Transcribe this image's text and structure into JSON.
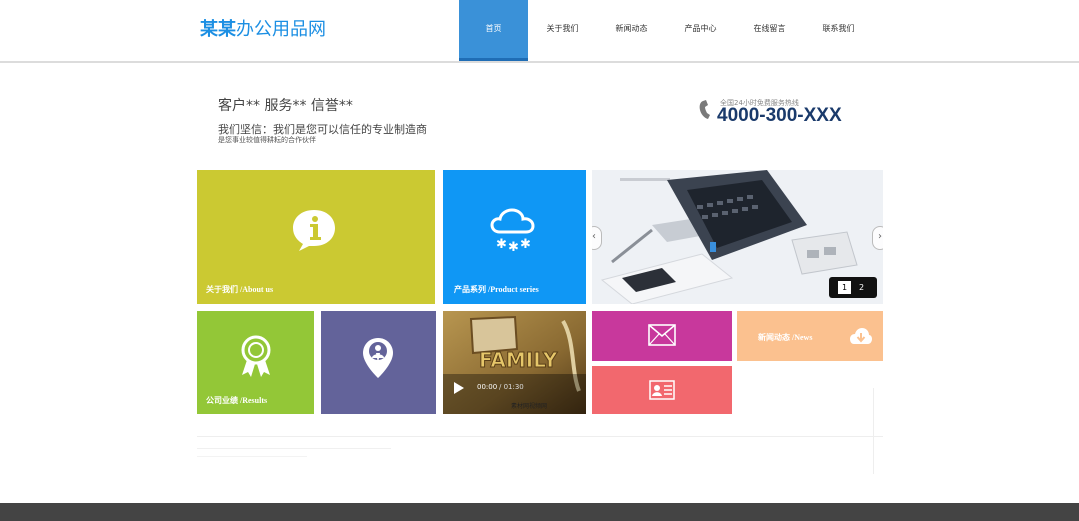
{
  "header": {
    "logo_bold": "某某",
    "logo_rest": "办公用品网",
    "nav": [
      {
        "label": "首页",
        "active": true
      },
      {
        "label": "关于我们",
        "active": false
      },
      {
        "label": "新闻动态",
        "active": false
      },
      {
        "label": "产品中心",
        "active": false
      },
      {
        "label": "在线留言",
        "active": false
      },
      {
        "label": "联系我们",
        "active": false
      }
    ]
  },
  "banner": {
    "slogan_main": "客户**  服务**  信誉**",
    "slogan_sub": "我们坚信：我们是您可以信任的专业制造商",
    "slogan_small": "是您事业较值得耕耘的合作伙伴",
    "hotline_label": "全国24小时免费服务热线",
    "hotline_number": "4000-300-XXX"
  },
  "tiles": {
    "about_label": "关于我们  /About us",
    "product_label": "产品系列  /Product series",
    "results_label": "公司业绩   /Results",
    "news_label": "新闻动态 /News"
  },
  "slider": {
    "pages": [
      "1",
      "2"
    ],
    "current_page": "1",
    "prev": "‹",
    "next": "›"
  },
  "video": {
    "time": "00:00",
    "duration": "/ 01:30",
    "caption": "素材网视频网"
  },
  "colors": {
    "accent": "#3a91d8",
    "about": "#cbc932",
    "product": "#0f97f5",
    "results": "#93c737",
    "locate": "#63639a",
    "mail": "#c8389c",
    "card": "#f2686e",
    "news": "#fbc18f"
  }
}
